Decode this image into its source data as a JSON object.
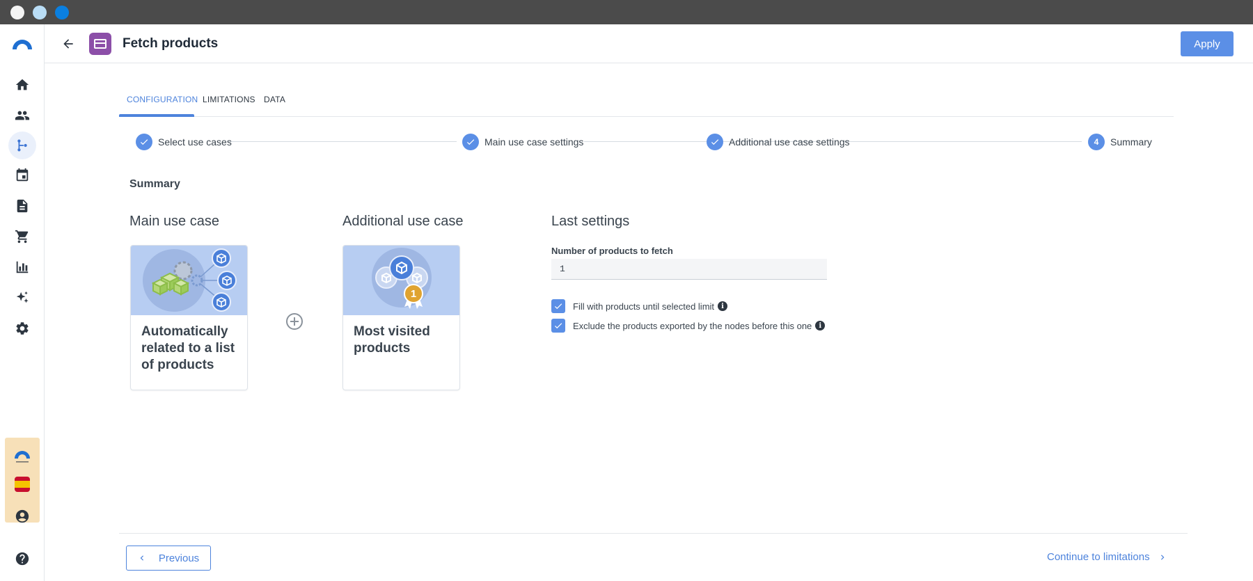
{
  "window": {
    "controls": [
      "close",
      "minimize",
      "maximize"
    ]
  },
  "sidebar": {
    "logo": "app-logo",
    "items": [
      {
        "icon": "home-icon",
        "active": false
      },
      {
        "icon": "people-icon",
        "active": false
      },
      {
        "icon": "flow-icon",
        "active": true
      },
      {
        "icon": "calendar-icon",
        "active": false
      },
      {
        "icon": "document-icon",
        "active": false
      },
      {
        "icon": "cart-icon",
        "active": false
      },
      {
        "icon": "bar-chart-icon",
        "active": false
      },
      {
        "icon": "sparkle-icon",
        "active": false
      },
      {
        "icon": "gear-icon",
        "active": false
      }
    ],
    "bottom": [
      "brand-logo",
      "spain-flag-icon",
      "account-icon",
      "help-icon"
    ]
  },
  "header": {
    "title": "Fetch products",
    "apply_label": "Apply"
  },
  "tabs": [
    {
      "label": "CONFIGURATION",
      "active": true
    },
    {
      "label": "LIMITATIONS",
      "active": false
    },
    {
      "label": "DATA",
      "active": false
    }
  ],
  "stepper": {
    "steps": [
      {
        "label": "Select use cases",
        "state": "done"
      },
      {
        "label": "Main use case settings",
        "state": "done"
      },
      {
        "label": "Additional use case settings",
        "state": "done"
      },
      {
        "label": "Summary",
        "state": "current",
        "number": "4"
      }
    ]
  },
  "summary": {
    "title": "Summary",
    "main_heading": "Main use case",
    "additional_heading": "Additional use case",
    "last_heading": "Last settings",
    "main_card": "Automatically related to a list of products",
    "additional_card": "Most visited products",
    "number_label": "Number of products to fetch",
    "number_value": "1",
    "checks": [
      {
        "label": "Fill with products until selected limit",
        "checked": true
      },
      {
        "label": "Exclude the products exported by the nodes before this one",
        "checked": true
      }
    ]
  },
  "footer": {
    "previous_label": "Previous",
    "continue_label": "Continue to limitations"
  },
  "colors": {
    "accent": "#5b8fe6",
    "node_purple": "#8c4fa8",
    "card_bg": "#b7cdf2",
    "brand_box": "#f7e0b8"
  }
}
